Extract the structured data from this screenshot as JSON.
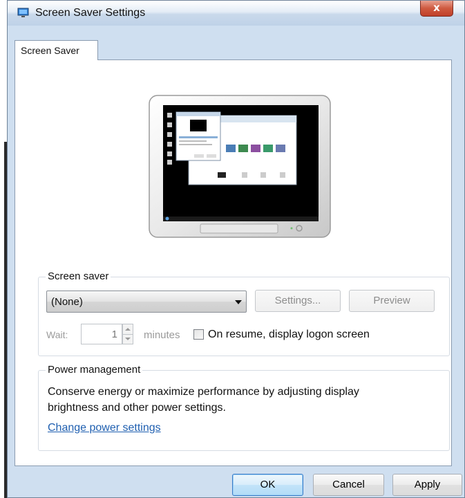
{
  "window": {
    "title": "Screen Saver Settings",
    "close_label": "x"
  },
  "tabs": [
    {
      "label": "Screen Saver",
      "active": true
    }
  ],
  "screen_saver": {
    "group_title": "Screen saver",
    "selected": "(None)",
    "settings_label": "Settings...",
    "preview_label": "Preview",
    "wait_label": "Wait:",
    "wait_value": "1",
    "minutes_label": "minutes",
    "on_resume_label": "On resume, display logon screen",
    "on_resume_checked": false
  },
  "power": {
    "group_title": "Power management",
    "description": "Conserve energy or maximize performance by adjusting display brightness and other power settings.",
    "link": "Change power settings"
  },
  "footer": {
    "ok_label": "OK",
    "cancel_label": "Cancel",
    "apply_label": "Apply"
  },
  "colors": {
    "titlebar": "#c9d9eb",
    "close": "#c0402a",
    "link": "#1f5fb0",
    "ok_accent": "#3a7bc8"
  }
}
